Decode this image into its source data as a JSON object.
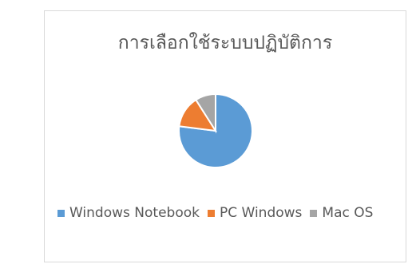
{
  "chart_data": {
    "type": "pie",
    "title": "การเลือกใช้ระบบปฏิบัติการ",
    "categories": [
      "Windows Notebook",
      "PC Windows",
      "Mac OS"
    ],
    "values": [
      77,
      14,
      9
    ],
    "colors": [
      "#5b9bd5",
      "#ed7d31",
      "#a5a5a5"
    ],
    "legend_position": "bottom"
  }
}
